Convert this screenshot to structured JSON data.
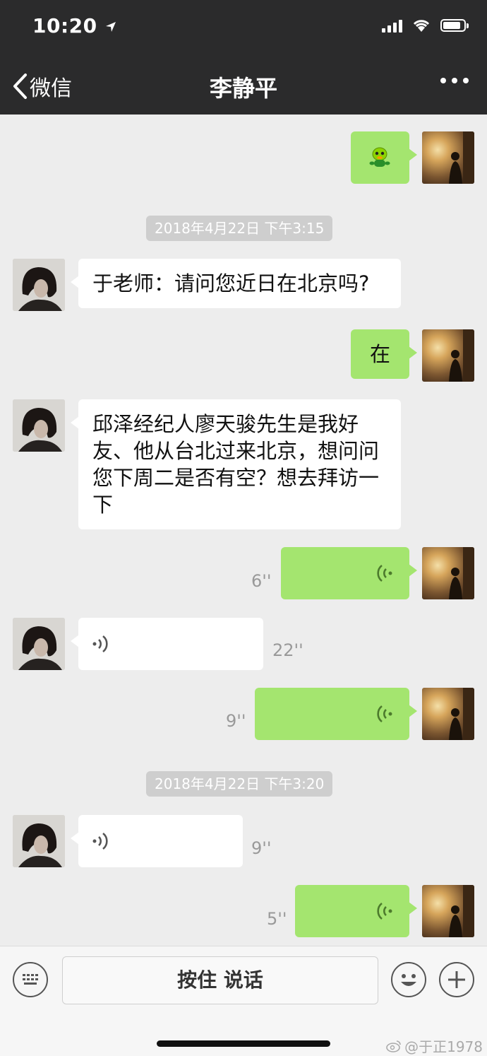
{
  "status_bar": {
    "time": "10:20"
  },
  "nav": {
    "back_label": "微信",
    "title": "李静平"
  },
  "timestamps": [
    "2018年4月22日 下午3:15",
    "2018年4月22日 下午3:20"
  ],
  "messages": {
    "m2_text": "于老师：请问您近日在北京吗?",
    "m3_text": "在",
    "m4_text": "邱泽经纪人廖天骏先生是我好友、他从台北过来北京，想问问您下周二是否有空？想去拜访一下",
    "m5_duration": "6''",
    "m6_duration": "22''",
    "m7_duration": "9''",
    "m8_duration": "9''",
    "m9_duration": "5''"
  },
  "input_bar": {
    "talk_label": "按住 说话"
  },
  "watermark": "@于正1978",
  "colors": {
    "my_bubble": "#a4e56f",
    "other_bubble": "#ffffff",
    "header": "#2b2b2c",
    "background": "#ededed"
  }
}
